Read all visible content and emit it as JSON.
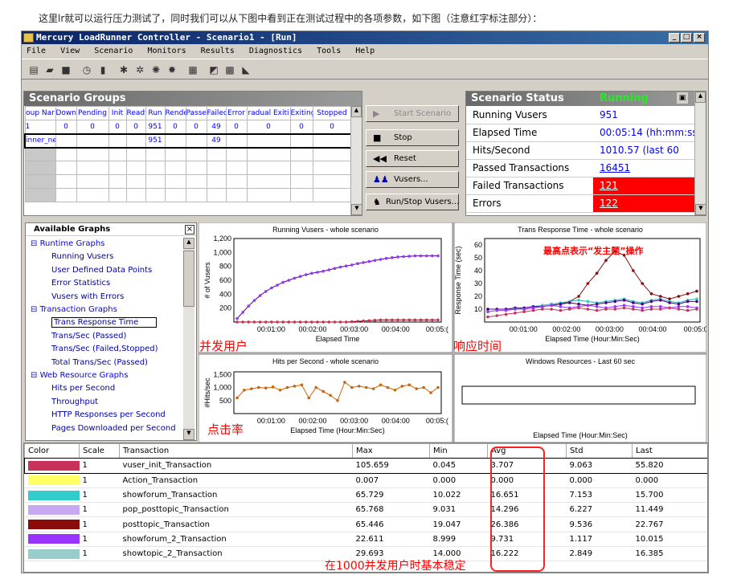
{
  "caption": "这里lr就可以运行压力测试了，同时我们可以从下图中看到正在测试过程中的各项参数，如下图（注意红字标注部分）：",
  "window": {
    "title": "Mercury LoadRunner Controller - Scenario1 - [Run]",
    "min": "_",
    "max": "□",
    "close": "×"
  },
  "menu": [
    "File",
    "View",
    "Scenario",
    "Monitors",
    "Results",
    "Diagnostics",
    "Tools",
    "Help"
  ],
  "groups": {
    "title": "Scenario Groups",
    "headers": [
      "oup Nar",
      "Down",
      "Pending",
      "Init",
      "Ready",
      "Run",
      "Rende",
      "Passe",
      "Failed",
      "Error",
      "radual Exiti",
      "Exiting",
      "Stopped"
    ],
    "totals": [
      "1",
      "0",
      "0",
      "0",
      "0",
      "951",
      "0",
      "0",
      "49",
      "0",
      "0",
      "0",
      "0"
    ],
    "row": [
      "inner_ne",
      "",
      "",
      "",
      "",
      "951",
      "",
      "",
      "49",
      "",
      "",
      "",
      ""
    ]
  },
  "buttons": {
    "start": "Start Scenario",
    "stop": "Stop",
    "reset": "Reset",
    "vusers": "Vusers...",
    "runstop": "Run/Stop Vusers..."
  },
  "status": {
    "title": "Scenario Status",
    "state": "Running",
    "rows": [
      {
        "label": "Running Vusers",
        "value": "951"
      },
      {
        "label": "Elapsed Time",
        "value": "00:05:14 (hh:mm:ss)"
      },
      {
        "label": "Hits/Second",
        "value": "1010.57 (last 60"
      },
      {
        "label": "Passed Transactions",
        "value": "16451"
      },
      {
        "label": "Failed Transactions",
        "value": "121"
      },
      {
        "label": "Errors",
        "value": "122"
      }
    ]
  },
  "graphs": {
    "title": "Available Graphs",
    "items": [
      "Runtime Graphs",
      "Running Vusers",
      "User Defined Data Points",
      "Error Statistics",
      "Vusers with Errors",
      "Transaction Graphs",
      "Trans Response Time",
      "Trans/Sec (Passed)",
      "Trans/Sec (Failed,Stopped)",
      "Total Trans/Sec (Passed)",
      "Web Resource Graphs",
      "Hits per Second",
      "Throughput",
      "HTTP Responses per Second",
      "Pages Downloaded per Second"
    ]
  },
  "chart_data": [
    {
      "type": "line",
      "title": "Running Vusers - whole scenario",
      "xlabel": "Elapsed Time",
      "ylabel": "# of Vusers",
      "ylim": [
        0,
        1200
      ],
      "yticks": [
        "1,200",
        "1,000",
        "800",
        "600",
        "400",
        "200"
      ],
      "xticks": [
        "00:01:00",
        "00:02:00",
        "00:03:00",
        "00:04:00",
        "00:05:("
      ],
      "series": [
        {
          "values": [
            50,
            140,
            230,
            310,
            380,
            440,
            490,
            530,
            570,
            600,
            630,
            655,
            680,
            700,
            715,
            730,
            750,
            770,
            790,
            805,
            820,
            840,
            855,
            870,
            885,
            900,
            915,
            925,
            935,
            940,
            945,
            950,
            950,
            950,
            951,
            951
          ]
        },
        {
          "values": [
            0,
            0,
            0,
            0,
            0,
            0,
            0,
            0,
            0,
            0,
            0,
            0,
            0,
            0,
            0,
            0,
            0,
            0,
            0,
            0,
            5,
            10,
            15,
            20,
            25,
            30,
            30,
            30,
            30,
            30,
            30,
            30,
            30,
            30,
            30,
            30
          ]
        }
      ]
    },
    {
      "type": "line",
      "title": "Trans Response Time - whole scenario",
      "xlabel": "Elapsed Time (Hour:Min:Sec)",
      "ylabel": "Response Time (sec)",
      "ylim": [
        0,
        65
      ],
      "yticks": [
        "60",
        "50",
        "40",
        "30",
        "20",
        "10"
      ],
      "xticks": [
        "00:01:00",
        "00:02:00",
        "00:03:00",
        "00:04:00",
        "00:05:0"
      ],
      "series": [
        {
          "values": [
            10,
            10,
            10,
            10,
            10,
            11,
            12,
            13,
            14,
            16,
            20,
            30,
            38,
            48,
            55,
            52,
            40,
            30,
            22,
            20,
            18,
            20,
            22,
            24
          ]
        },
        {
          "values": [
            10,
            10,
            10,
            10,
            11,
            12,
            13,
            14,
            15,
            16,
            17,
            16,
            15,
            16,
            17,
            18,
            16,
            15,
            17,
            18,
            16,
            15,
            17,
            18
          ]
        },
        {
          "values": [
            10,
            10,
            10,
            11,
            11,
            12,
            12,
            13,
            14,
            15,
            14,
            13,
            14,
            15,
            16,
            17,
            15,
            14,
            16,
            17,
            15,
            14,
            16,
            16
          ]
        },
        {
          "values": [
            8,
            9,
            9,
            10,
            10,
            11,
            12,
            13,
            12,
            11,
            12,
            13,
            12,
            11,
            12,
            13,
            12,
            11,
            12,
            12,
            11,
            12,
            12,
            11
          ]
        },
        {
          "values": [
            4,
            5,
            6,
            7,
            8,
            9,
            10,
            10,
            9,
            10,
            11,
            10,
            9,
            10,
            10,
            11,
            10,
            9,
            10,
            10,
            11,
            10,
            9,
            10
          ]
        }
      ]
    },
    {
      "type": "line",
      "title": "Hits per Second - whole scenario",
      "xlabel": "Elapsed Time (Hour:Min:Sec)",
      "ylabel": "#Hits/sec",
      "ylim": [
        0,
        1600
      ],
      "yticks": [
        "1,500",
        "1,000",
        "500"
      ],
      "xticks": [
        "00:01:00",
        "00:02:00",
        "00:03:00",
        "00:04:00",
        "00:05:("
      ],
      "series": [
        {
          "values": [
            600,
            900,
            950,
            1000,
            980,
            1020,
            900,
            1000,
            1050,
            1100,
            600,
            1000,
            850,
            700,
            500,
            1200,
            1000,
            1050,
            1000,
            950,
            1100,
            1000,
            900,
            1050,
            1100,
            950,
            1000,
            800,
            1000
          ]
        }
      ]
    },
    {
      "type": "line",
      "title": "Windows Resources - Last 60 sec",
      "xlabel": "Elapsed Time (Hour:Min:Sec)"
    }
  ],
  "annotations": {
    "vusers": "并发用户",
    "resp": "响应时间",
    "hits": "点击率",
    "peak": "最高点表示“发主题”操作",
    "stable": "在1000并发用户时基本稳定"
  },
  "legend": {
    "headers": [
      "Color",
      "Scale",
      "Transaction",
      "Max",
      "Min",
      "Avg",
      "Std",
      "Last"
    ],
    "rows": [
      {
        "color": "#c8325a",
        "scale": "1",
        "name": "vuser_init_Transaction",
        "max": "105.659",
        "min": "0.045",
        "avg": "3.707",
        "std": "9.063",
        "last": "55.820"
      },
      {
        "color": "#ffff66",
        "scale": "1",
        "name": "Action_Transaction",
        "max": "0.007",
        "min": "0.000",
        "avg": "0.000",
        "std": "0.000",
        "last": "0.000"
      },
      {
        "color": "#33cccc",
        "scale": "1",
        "name": "showforum_Transaction",
        "max": "65.729",
        "min": "10.022",
        "avg": "16.651",
        "std": "7.153",
        "last": "15.700"
      },
      {
        "color": "#c8a8f0",
        "scale": "1",
        "name": "pop_posttopic_Transaction",
        "max": "65.768",
        "min": "9.031",
        "avg": "14.296",
        "std": "6.227",
        "last": "11.449"
      },
      {
        "color": "#8b0a0a",
        "scale": "1",
        "name": "posttopic_Transaction",
        "max": "65.446",
        "min": "19.047",
        "avg": "26.386",
        "std": "9.536",
        "last": "22.767"
      },
      {
        "color": "#9933ff",
        "scale": "1",
        "name": "showforum_2_Transaction",
        "max": "22.611",
        "min": "8.999",
        "avg": "9.731",
        "std": "1.117",
        "last": "10.015"
      },
      {
        "color": "#99cccc",
        "scale": "1",
        "name": "showtopic_2_Transaction",
        "max": "29.693",
        "min": "14.000",
        "avg": "16.222",
        "std": "2.849",
        "last": "16.385"
      }
    ]
  }
}
